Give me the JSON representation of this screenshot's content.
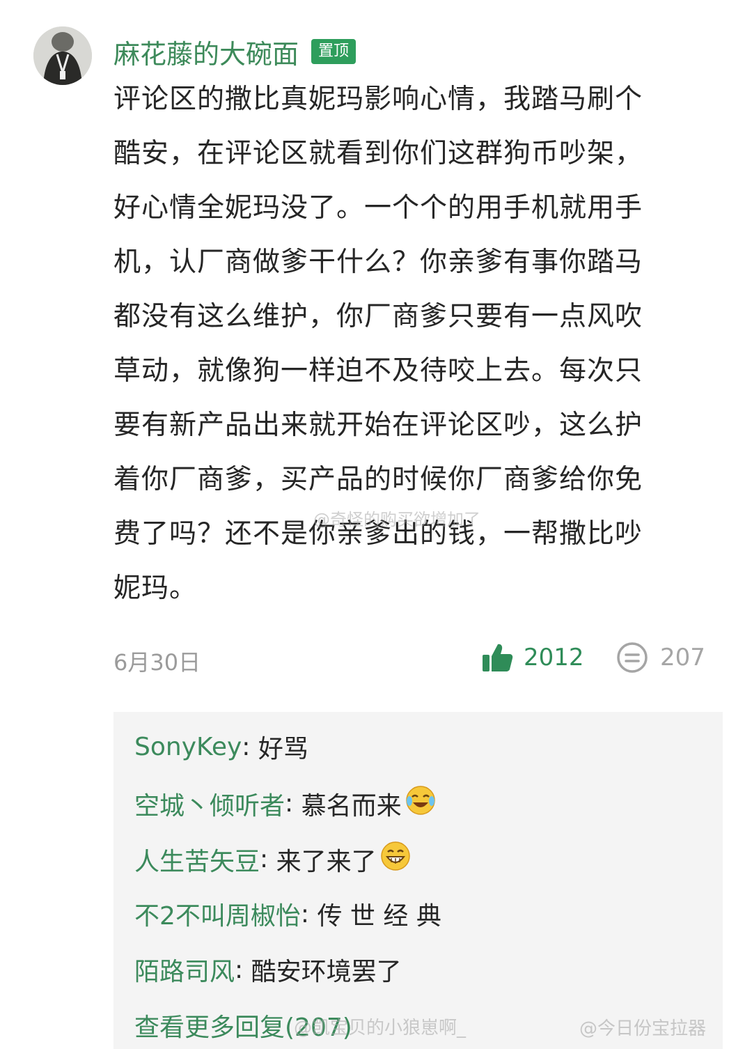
{
  "comment": {
    "author": "麻花藤的大碗面",
    "pin_badge": "置顶",
    "body_lines": [
      "评论区的撒比真妮玛影响心情，我踏马刷个",
      "酷安，在评论区就看到你们这群狗币吵架，",
      "好心情全妮玛没了。一个个的用手机就用手",
      "机，认厂商做爹干什么？你亲爹有事你踏马",
      "都没有这么维护，你厂商爹只要有一点风吹",
      "草动，就像狗一样迫不及待咬上去。每次只",
      "要有新产品出来就开始在评论区吵，这么护",
      "着你厂商爹，买产品的时候你厂商爹给你免",
      "费了吗？还不是你亲爹出的钱，一帮撒比吵",
      "妮玛。"
    ],
    "date": "6月30日",
    "like_count": "2012",
    "reply_count": "207",
    "icons": {
      "like": "thumbs-up-icon",
      "reply": "comment-icon"
    },
    "colors": {
      "accent": "#2e9e5c",
      "username": "#3c8a5c",
      "muted": "#9b9b9b"
    }
  },
  "replies": [
    {
      "user": "SonyKey",
      "text": "好骂",
      "emoji": ""
    },
    {
      "user": "空城丶倾听者",
      "text": "慕名而来",
      "emoji": "laughing-tears-emoji"
    },
    {
      "user": "人生苦矢豆",
      "text": "来了来了",
      "emoji": "grinning-emoji"
    },
    {
      "user": "不2不叫周椒怡",
      "text": "传 世 经 典",
      "emoji": ""
    },
    {
      "user": "陌路司风",
      "text": "酷安环境罢了",
      "emoji": ""
    }
  ],
  "more_replies": "查看更多回复(207)",
  "watermarks": {
    "middle": "@奇怪的购买欲增加了",
    "bottom_left": "@凯宝贝的小狼崽啊_",
    "bottom_right": "@今日份宝拉器"
  }
}
